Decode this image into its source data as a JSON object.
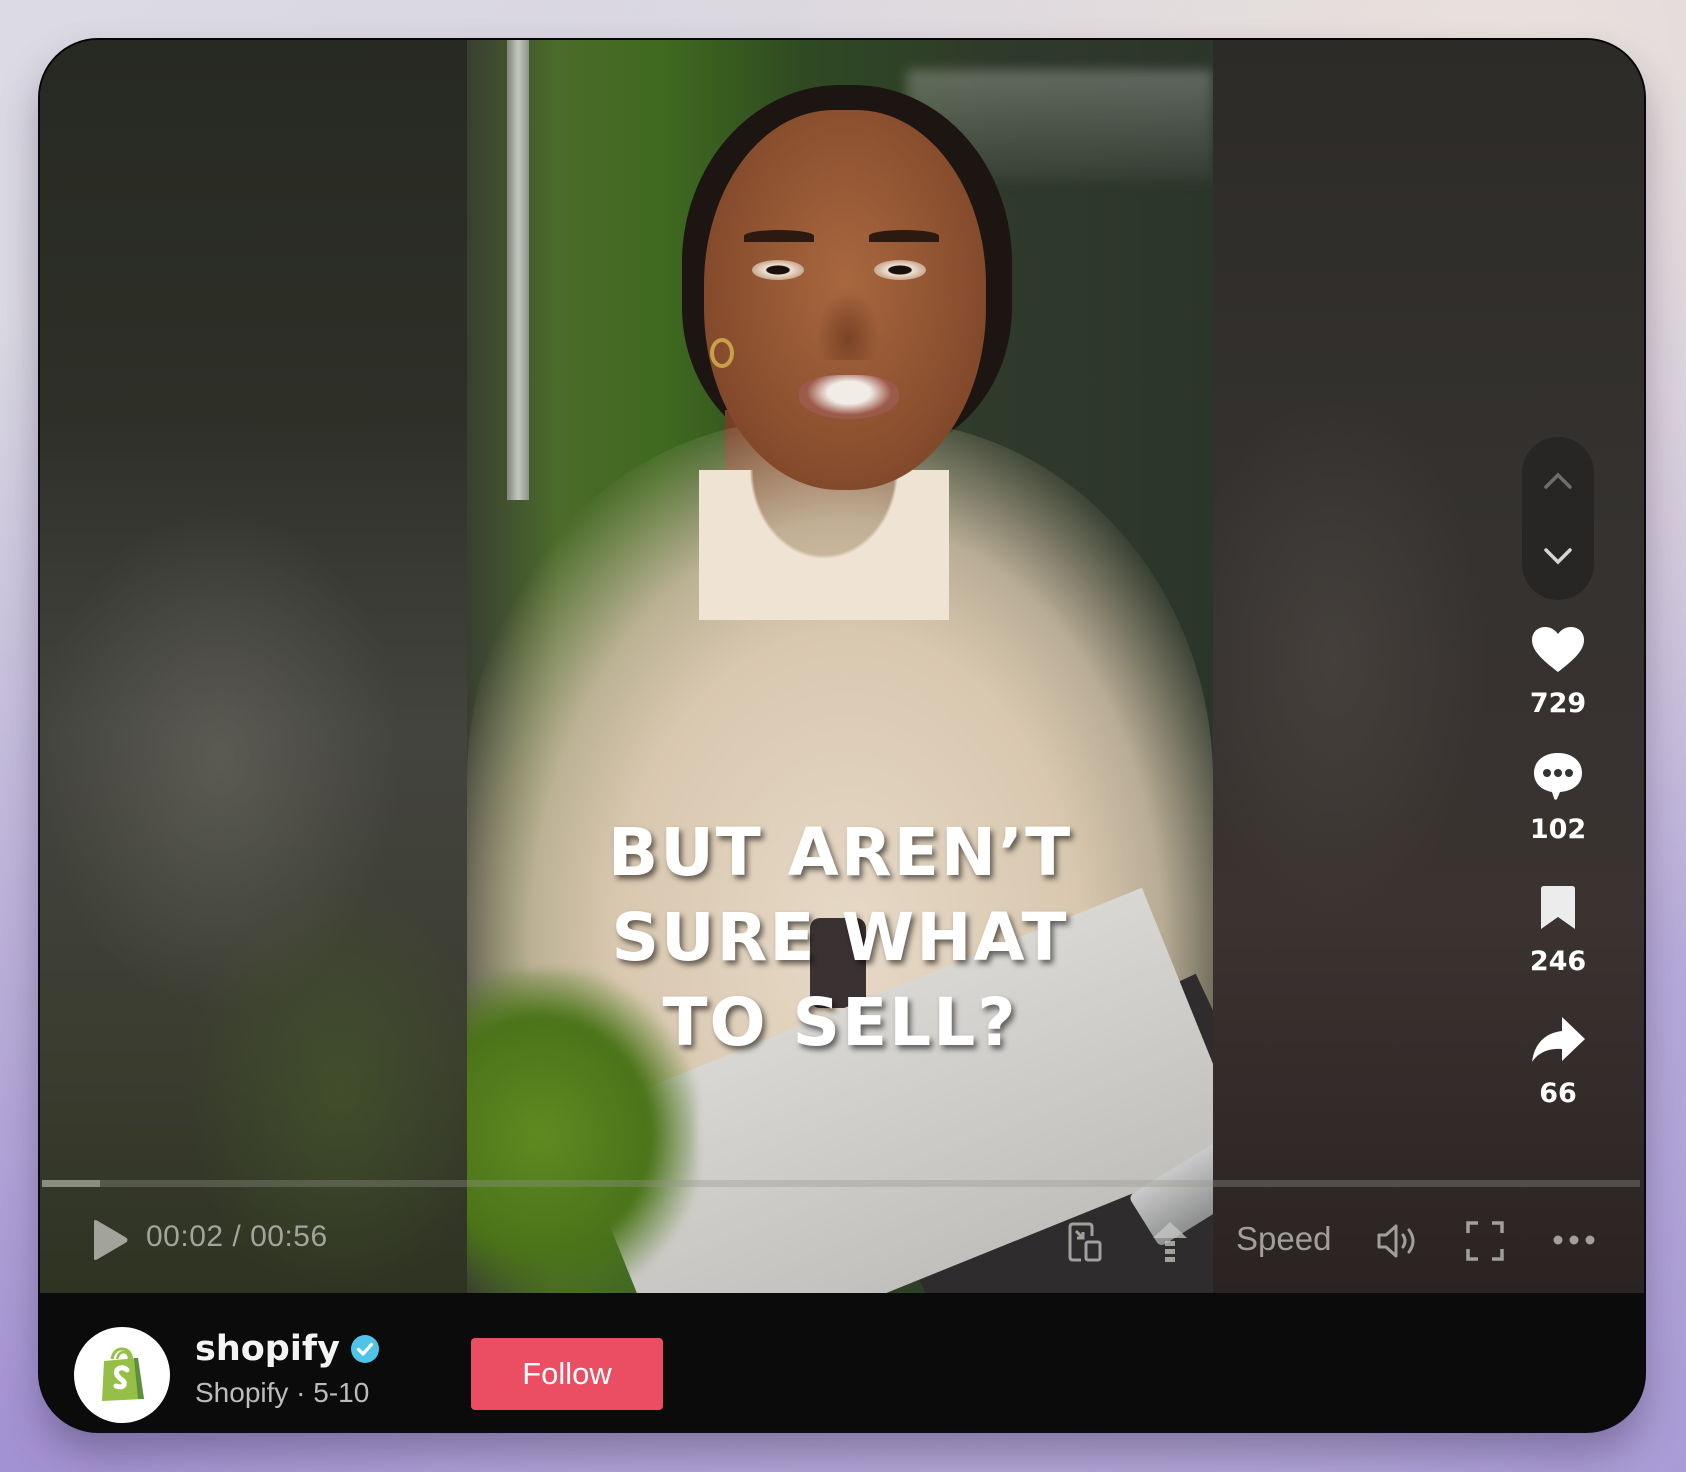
{
  "video": {
    "caption_lines": [
      "BUT AREN’T",
      "SURE WHAT",
      "TO SELL?"
    ],
    "progress_fraction": 0.036,
    "current_time": "00:02",
    "duration": "00:56",
    "time_display": "00:02 / 00:56"
  },
  "controls": {
    "play_icon": "play-icon",
    "pip_icon": "picture-in-picture-icon",
    "upload_icon": "arrow-up-icon",
    "speed_label": "Speed",
    "volume_icon": "volume-icon",
    "fullscreen_icon": "fullscreen-icon",
    "more_icon": "more-horizontal-icon"
  },
  "navigation": {
    "prev_icon": "chevron-up-icon",
    "next_icon": "chevron-down-icon"
  },
  "actions": [
    {
      "name": "like",
      "icon": "heart-icon",
      "count": "729"
    },
    {
      "name": "comment",
      "icon": "comment-icon",
      "count": "102"
    },
    {
      "name": "save",
      "icon": "bookmark-icon",
      "count": "246"
    },
    {
      "name": "share",
      "icon": "share-arrow-icon",
      "count": "66"
    }
  ],
  "author": {
    "username": "shopify",
    "verified": true,
    "display_name": "Shopify",
    "date": "5-10",
    "subline": "Shopify · 5-10",
    "avatar_icon": "shopify-bag-logo"
  },
  "follow_label": "Follow",
  "colors": {
    "follow": "#eb4d62",
    "verified": "#20d5ec",
    "shopify_green": "#95bf47"
  }
}
